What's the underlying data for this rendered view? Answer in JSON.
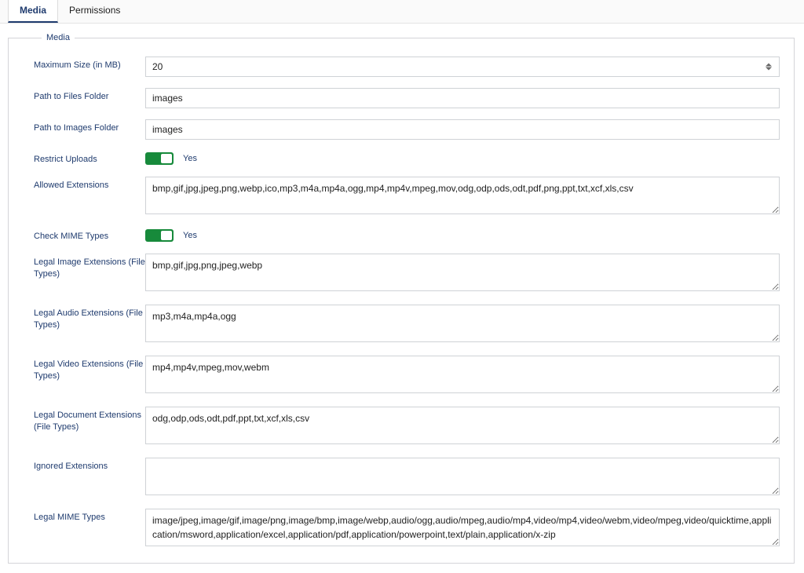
{
  "tabs": {
    "media": "Media",
    "permissions": "Permissions"
  },
  "fieldset_legend": "Media",
  "labels": {
    "max_size": "Maximum Size (in MB)",
    "files_folder": "Path to Files Folder",
    "images_folder": "Path to Images Folder",
    "restrict_uploads": "Restrict Uploads",
    "allowed_ext": "Allowed Extensions",
    "check_mime": "Check MIME Types",
    "legal_image": "Legal Image Extensions (File Types)",
    "legal_audio": "Legal Audio Extensions (File Types)",
    "legal_video": "Legal Video Extensions (File Types)",
    "legal_doc": "Legal Document Extensions (File Types)",
    "ignored_ext": "Ignored Extensions",
    "legal_mime": "Legal MIME Types"
  },
  "values": {
    "max_size": "20",
    "files_folder": "images",
    "images_folder": "images",
    "restrict_uploads_state": "Yes",
    "allowed_ext": "bmp,gif,jpg,jpeg,png,webp,ico,mp3,m4a,mp4a,ogg,mp4,mp4v,mpeg,mov,odg,odp,ods,odt,pdf,png,ppt,txt,xcf,xls,csv",
    "check_mime_state": "Yes",
    "legal_image": "bmp,gif,jpg,png,jpeg,webp",
    "legal_audio": "mp3,m4a,mp4a,ogg",
    "legal_video": "mp4,mp4v,mpeg,mov,webm",
    "legal_doc": "odg,odp,ods,odt,pdf,ppt,txt,xcf,xls,csv",
    "ignored_ext": "",
    "legal_mime": "image/jpeg,image/gif,image/png,image/bmp,image/webp,audio/ogg,audio/mpeg,audio/mp4,video/mp4,video/webm,video/mpeg,video/quicktime,application/msword,application/excel,application/pdf,application/powerpoint,text/plain,application/x-zip"
  }
}
